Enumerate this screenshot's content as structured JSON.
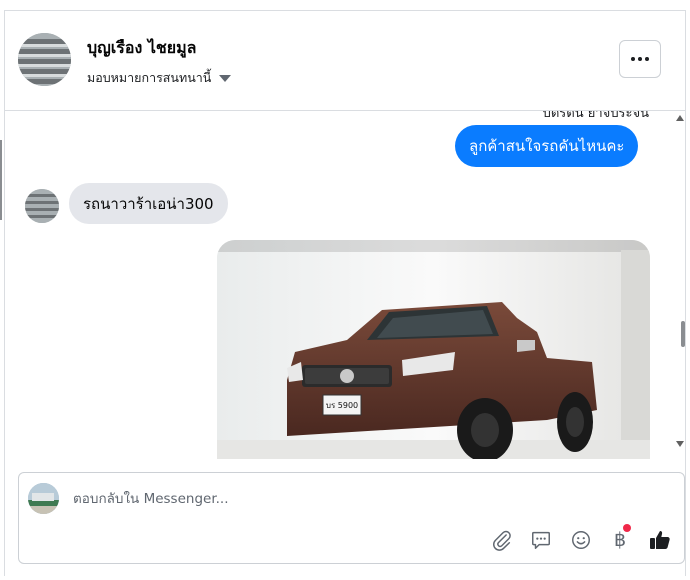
{
  "header": {
    "contact_name": "บุญเรือง ไชยมูล",
    "assign_label": "มอบหมายการสนทนานี้"
  },
  "messages": [
    {
      "direction": "out",
      "text": "บัตรตัน ยาจประจน",
      "partial": true
    },
    {
      "direction": "out",
      "text": "ลูกค้าสนใจรถคันไหนคะ"
    },
    {
      "direction": "in",
      "text": "รถนาวาร้าเอน่า300"
    },
    {
      "direction": "out",
      "type": "image",
      "plate_text": "บร 5900"
    }
  ],
  "composer": {
    "placeholder": "ตอบกลับใน Messenger..."
  },
  "icons": {
    "more": "more-horizontal-icon",
    "assign_caret": "caret-down-icon",
    "attach": "paperclip-icon",
    "saved_reply": "chat-bubble-icon",
    "emoji": "smiley-icon",
    "payment": "baht-icon",
    "like": "thumbs-up-icon"
  },
  "colors": {
    "outgoing_bubble": "#0a7cff",
    "incoming_bubble": "#e4e6eb",
    "notification_dot": "#f02849"
  }
}
